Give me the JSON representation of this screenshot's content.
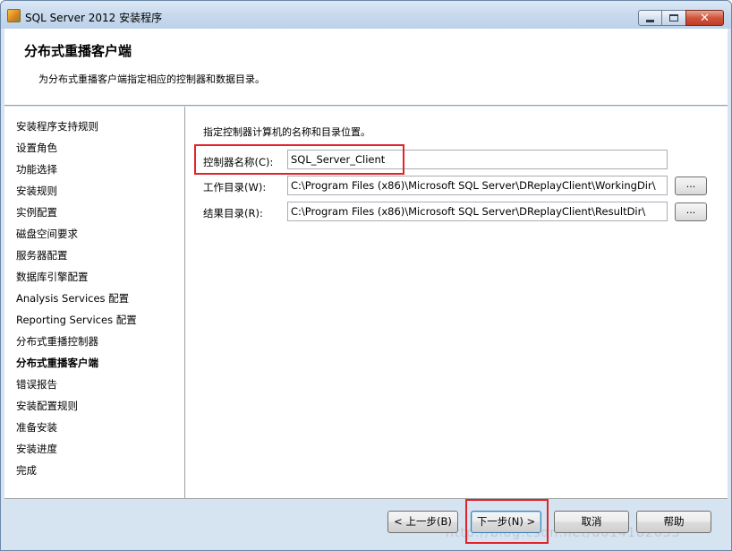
{
  "window": {
    "title": "SQL Server 2012 安装程序",
    "icon": "sql-setup-icon",
    "controls": {
      "minimize": "minimize",
      "maximize": "maximize",
      "close": "✕"
    }
  },
  "header": {
    "title": "分布式重播客户端",
    "subtitle": "为分布式重播客户端指定相应的控制器和数据目录。"
  },
  "sidebar": {
    "steps": [
      {
        "label": "安装程序支持规则",
        "active": false
      },
      {
        "label": "设置角色",
        "active": false
      },
      {
        "label": "功能选择",
        "active": false
      },
      {
        "label": "安装规则",
        "active": false
      },
      {
        "label": "实例配置",
        "active": false
      },
      {
        "label": "磁盘空间要求",
        "active": false
      },
      {
        "label": "服务器配置",
        "active": false
      },
      {
        "label": "数据库引擎配置",
        "active": false
      },
      {
        "label": "Analysis Services 配置",
        "active": false
      },
      {
        "label": "Reporting Services 配置",
        "active": false
      },
      {
        "label": "分布式重播控制器",
        "active": false
      },
      {
        "label": "分布式重播客户端",
        "active": true
      },
      {
        "label": "错误报告",
        "active": false
      },
      {
        "label": "安装配置规则",
        "active": false
      },
      {
        "label": "准备安装",
        "active": false
      },
      {
        "label": "安装进度",
        "active": false
      },
      {
        "label": "完成",
        "active": false
      }
    ]
  },
  "main": {
    "instruction": "指定控制器计算机的名称和目录位置。",
    "controller": {
      "label": "控制器名称(C):",
      "value": "SQL_Server_Client"
    },
    "working_dir": {
      "label": "工作目录(W):",
      "value": "C:\\Program Files (x86)\\Microsoft SQL Server\\DReplayClient\\WorkingDir\\",
      "browse": "..."
    },
    "result_dir": {
      "label": "结果目录(R):",
      "value": "C:\\Program Files (x86)\\Microsoft SQL Server\\DReplayClient\\ResultDir\\",
      "browse": "..."
    }
  },
  "footer": {
    "back": "< 上一步(B)",
    "next": "下一步(N) >",
    "cancel": "取消",
    "help": "帮助"
  },
  "watermark": "http://blog.csdn.net/u014182655",
  "colors": {
    "highlight": "#e0242a",
    "titlebar": "#c7d9ed",
    "close": "#c13c24"
  }
}
